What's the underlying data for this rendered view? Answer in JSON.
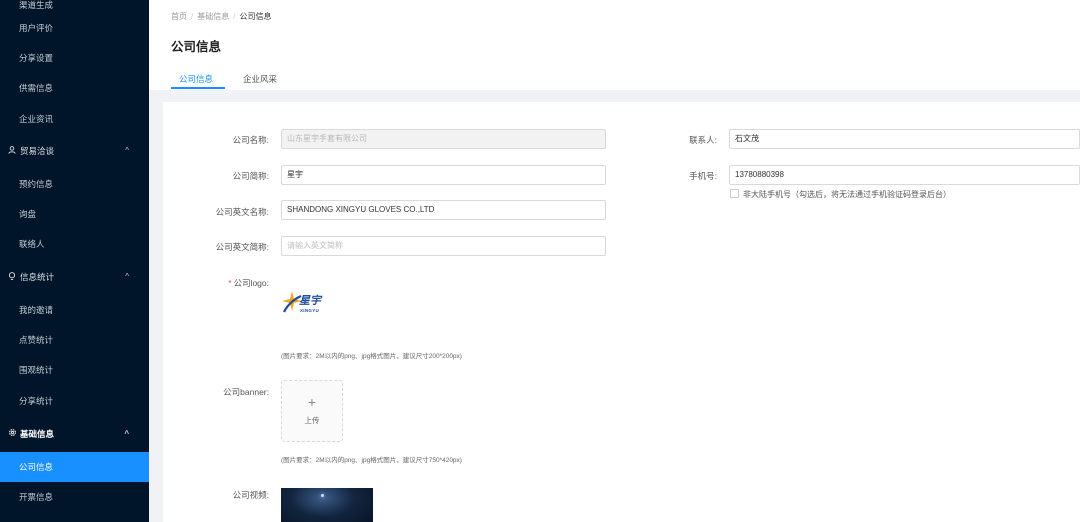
{
  "sidebar": {
    "partial_top": "渠道生成",
    "items_a": [
      "用户评价",
      "分享设置",
      "供需信息",
      "企业资讯"
    ],
    "group_trade": {
      "label": "贸易洽谈",
      "icon": "person-icon",
      "chevron": "^"
    },
    "items_b": [
      "预约信息",
      "询盘",
      "联络人"
    ],
    "group_stats": {
      "label": "信息统计",
      "icon": "bulb-icon",
      "chevron": "^"
    },
    "items_c": [
      "我的邀请",
      "点赞统计",
      "围观统计",
      "分享统计"
    ],
    "group_basic": {
      "label": "基础信息",
      "icon": "gear-icon",
      "chevron": "^"
    },
    "items_d": [
      "公司信息",
      "开票信息"
    ],
    "active": "公司信息",
    "colors": {
      "bg": "#001529",
      "active": "#1890ff"
    }
  },
  "breadcrumb": {
    "home": "首页",
    "sep": "/",
    "level2": "基础信息",
    "current": "公司信息"
  },
  "page_title": "公司信息",
  "tabs": [
    {
      "label": "公司信息",
      "active": true
    },
    {
      "label": "企业风采",
      "active": false
    }
  ],
  "form": {
    "company_name": {
      "label": "公司名称:",
      "value": "山东星宇手套有限公司",
      "disabled": true
    },
    "short_name": {
      "label": "公司简称:",
      "value": "星宇"
    },
    "english_name": {
      "label": "公司英文名称:",
      "value": "SHANDONG XINGYU GLOVES CO.,LTD"
    },
    "english_short": {
      "label": "公司英文简称:",
      "value": "",
      "placeholder": "请输入英文简称"
    },
    "contact": {
      "label": "联系人:",
      "value": "石文茂"
    },
    "phone": {
      "label": "手机号:",
      "value": "13780880398"
    },
    "non_mainland": {
      "label": "非大陆手机号（勾选后，将无法通过手机验证码登录后台）",
      "checked": false
    },
    "logo": {
      "label": "公司logo:",
      "brand": "星宇",
      "brand_en": "XINGYU",
      "hint": "(图片要求：2M以内的png、jpg格式图片，建议尺寸200*200px)"
    },
    "banner": {
      "label": "公司banner:",
      "upload_icon": "+",
      "upload_label": "上传",
      "hint": "(图片要求：2M以内的png、jpg格式图片，建议尺寸750*420px)"
    },
    "video": {
      "label": "公司视频:"
    }
  }
}
